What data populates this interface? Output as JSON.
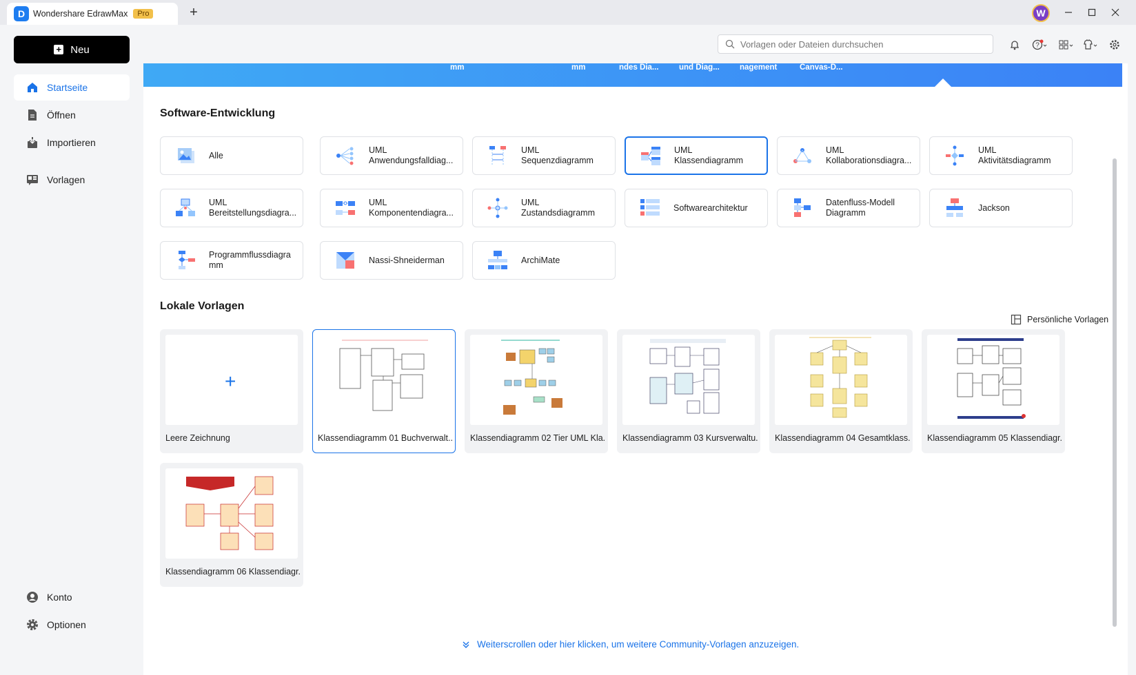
{
  "app": {
    "title": "Wondershare EdrawMax",
    "badge": "Pro",
    "avatar_initial": "W"
  },
  "sidebar": {
    "new_label": "Neu",
    "items": [
      {
        "label": "Startseite",
        "icon": "home-icon"
      },
      {
        "label": "Öffnen",
        "icon": "file-icon"
      },
      {
        "label": "Importieren",
        "icon": "import-icon"
      },
      {
        "label": "Vorlagen",
        "icon": "templates-icon"
      }
    ],
    "bottom": [
      {
        "label": "Konto",
        "icon": "account-icon"
      },
      {
        "label": "Optionen",
        "icon": "settings-icon"
      }
    ]
  },
  "search": {
    "placeholder": "Vorlagen oder Dateien durchsuchen"
  },
  "banner": {
    "labels": [
      "mm",
      "mm",
      "ndes Dia...",
      "und Diag...",
      "nagement",
      "Canvas-D..."
    ]
  },
  "software": {
    "title": "Software-Entwicklung",
    "categories": [
      {
        "label": "Alle"
      },
      {
        "label": "UML\nAnwendungsfalldiag..."
      },
      {
        "label": "UML\nSequenzdiagramm"
      },
      {
        "label": "UML\nKlassendiagramm"
      },
      {
        "label": "UML\nKollaborationsdiagra..."
      },
      {
        "label": "UML\nAktivitätsdiagramm"
      },
      {
        "label": "UML\nBereitstellungsdiagra..."
      },
      {
        "label": "UML\nKomponentendiagra..."
      },
      {
        "label": "UML\nZustandsdiagramm"
      },
      {
        "label": "Softwarearchitektur"
      },
      {
        "label": "Datenfluss-Modell\nDiagramm"
      },
      {
        "label": "Jackson"
      },
      {
        "label": "Programmflussdiagra\nmm"
      },
      {
        "label": "Nassi-Shneiderman"
      },
      {
        "label": "ArchiMate"
      }
    ]
  },
  "local": {
    "title": "Lokale Vorlagen",
    "personal_link": "Persönliche Vorlagen",
    "templates": [
      {
        "label": "Leere Zeichnung"
      },
      {
        "label": "Klassendiagramm 01 Buchverwalt..."
      },
      {
        "label": "Klassendiagramm 02 Tier UML Kla..."
      },
      {
        "label": "Klassendiagramm 03 Kursverwaltu..."
      },
      {
        "label": "Klassendiagramm 04 Gesamtklass..."
      },
      {
        "label": "Klassendiagramm 05 Klassendiagr..."
      },
      {
        "label": "Klassendiagramm 06 Klassendiagr..."
      }
    ],
    "more_link": "Weiterscrollen oder hier klicken, um weitere Community-Vorlagen anzuzeigen."
  }
}
